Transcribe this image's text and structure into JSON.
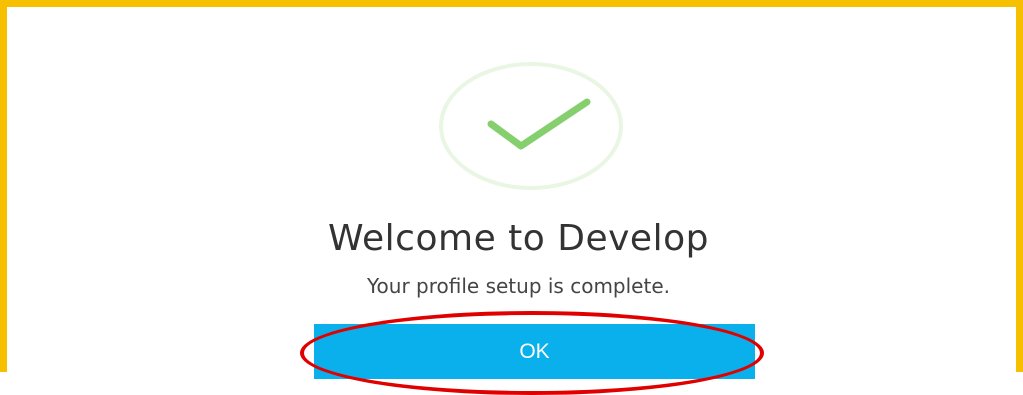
{
  "dialog": {
    "icon": "checkmark-icon",
    "title": "Welcome to Develop",
    "subtitle": "Your profile setup is complete.",
    "ok_label": "OK"
  },
  "colors": {
    "frame_border": "#f6c000",
    "check": "#86cf6f",
    "check_circle": "#e9f6e3",
    "button_bg": "#0ab0ec",
    "button_text": "#ffffff",
    "title_text": "#333333",
    "annotation": "#e00000"
  }
}
